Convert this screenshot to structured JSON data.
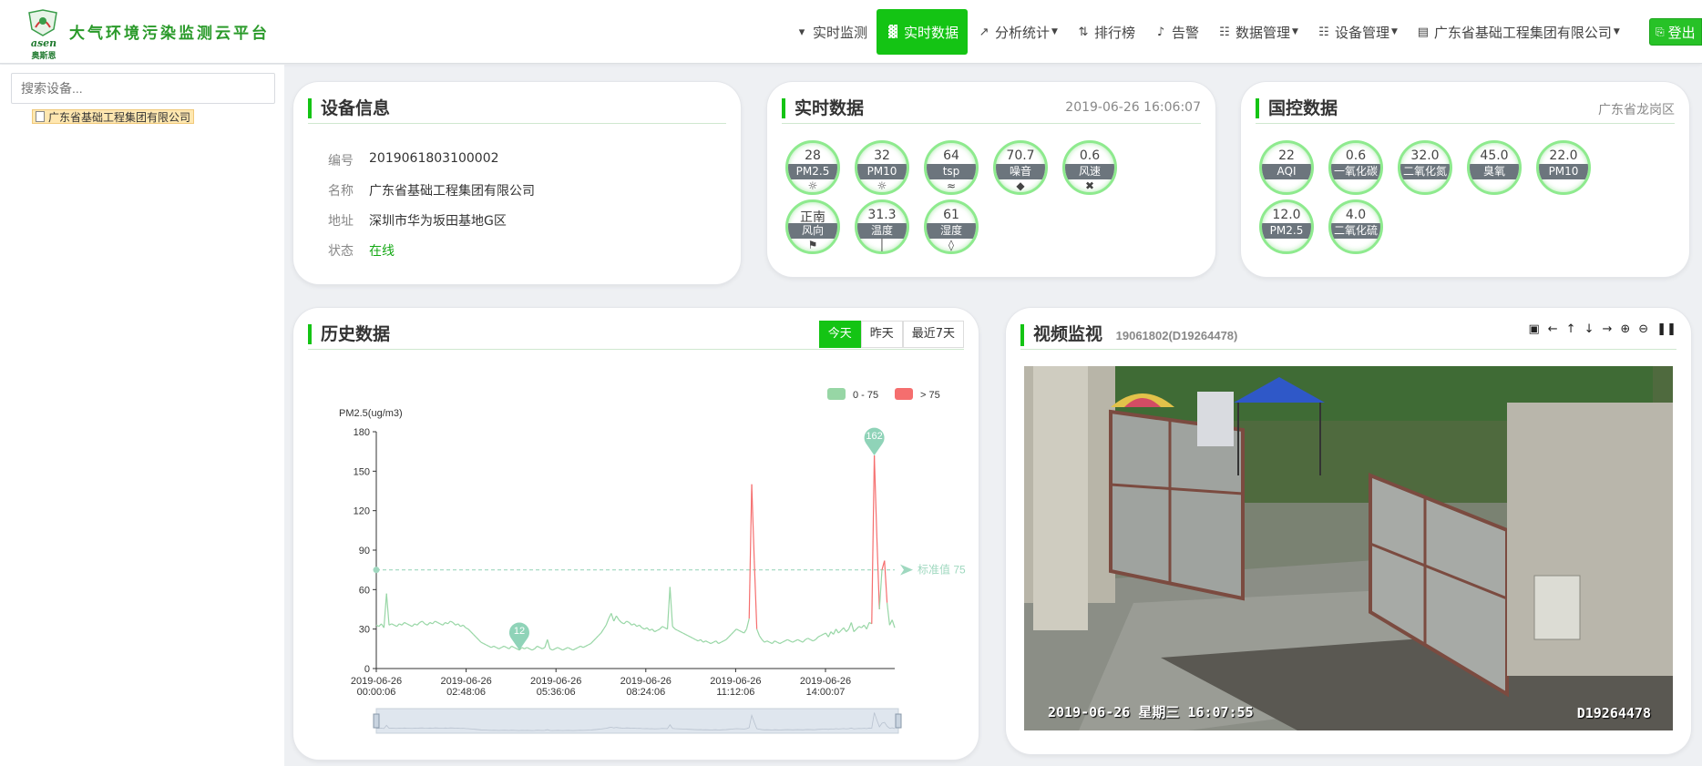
{
  "header": {
    "logo_en": "asen",
    "logo_cn": "奥斯恩",
    "app_title": "大气环境污染监测云平台",
    "nav": [
      {
        "label": "实时监测",
        "icon": "map-marker-icon",
        "active": false,
        "caret": false
      },
      {
        "label": "实时数据",
        "icon": "bar-chart-icon",
        "active": true,
        "caret": false
      },
      {
        "label": "分析统计",
        "icon": "line-chart-icon",
        "active": false,
        "caret": true
      },
      {
        "label": "排行榜",
        "icon": "sort-icon",
        "active": false,
        "caret": false
      },
      {
        "label": "告警",
        "icon": "bell-icon",
        "active": false,
        "caret": false
      },
      {
        "label": "数据管理",
        "icon": "sitemap-icon",
        "active": false,
        "caret": true
      },
      {
        "label": "设备管理",
        "icon": "sitemap-icon",
        "active": false,
        "caret": true
      },
      {
        "label": "广东省基础工程集团有限公司",
        "icon": "id-card-icon",
        "active": false,
        "caret": true
      }
    ],
    "logout": "登出"
  },
  "sidebar": {
    "search_placeholder": "搜索设备...",
    "tree": [
      {
        "label": "广东省基础工程集团有限公司",
        "selected": true
      }
    ]
  },
  "device_info": {
    "title": "设备信息",
    "rows": [
      {
        "key": "编号",
        "value": "2019061803100002"
      },
      {
        "key": "名称",
        "value": "广东省基础工程集团有限公司"
      },
      {
        "key": "地址",
        "value": "深圳市华为坂田基地G区"
      },
      {
        "key": "状态",
        "value": "在线"
      }
    ]
  },
  "realtime": {
    "title": "实时数据",
    "timestamp": "2019-06-26 16:06:07",
    "gauges": [
      {
        "value": "28",
        "label": "PM2.5",
        "icon": "sun-icon"
      },
      {
        "value": "32",
        "label": "PM10",
        "icon": "sun-icon"
      },
      {
        "value": "64",
        "label": "tsp",
        "icon": "haze-icon"
      },
      {
        "value": "70.7",
        "label": "噪音",
        "icon": "horn-icon"
      },
      {
        "value": "0.6",
        "label": "风速",
        "icon": "fan-icon"
      },
      {
        "value": "正南",
        "label": "风向",
        "icon": "flag-icon"
      },
      {
        "value": "31.3",
        "label": "温度",
        "icon": "thermometer-icon"
      },
      {
        "value": "61",
        "label": "湿度",
        "icon": "drop-icon"
      }
    ]
  },
  "national": {
    "title": "国控数据",
    "location": "广东省龙岗区",
    "gauges": [
      {
        "value": "22",
        "label": "AQI"
      },
      {
        "value": "0.6",
        "label": "一氧化碳"
      },
      {
        "value": "32.0",
        "label": "二氧化氮"
      },
      {
        "value": "45.0",
        "label": "臭氧"
      },
      {
        "value": "22.0",
        "label": "PM10"
      },
      {
        "value": "12.0",
        "label": "PM2.5"
      },
      {
        "value": "4.0",
        "label": "二氧化硫"
      }
    ]
  },
  "history": {
    "title": "历史数据",
    "ranges": [
      {
        "label": "今天",
        "active": true
      },
      {
        "label": "昨天",
        "active": false
      },
      {
        "label": "最近7天",
        "active": false
      }
    ]
  },
  "chart_data": {
    "type": "line",
    "ylabel": "PM2.5(ug/m3)",
    "ylim": [
      0,
      180
    ],
    "yticks": [
      0,
      30,
      60,
      90,
      120,
      150,
      180
    ],
    "xticks": [
      {
        "date": "2019-06-26",
        "time": "00:00:06"
      },
      {
        "date": "2019-06-26",
        "time": "02:48:06"
      },
      {
        "date": "2019-06-26",
        "time": "05:36:06"
      },
      {
        "date": "2019-06-26",
        "time": "08:24:06"
      },
      {
        "date": "2019-06-26",
        "time": "11:12:06"
      },
      {
        "date": "2019-06-26",
        "time": "14:00:07"
      }
    ],
    "legend": [
      {
        "label": "0 - 75",
        "color": "#97d6a5"
      },
      {
        "label": "> 75",
        "color": "#f56e6e"
      }
    ],
    "threshold": {
      "label": "标准值 75",
      "value": 75,
      "color": "#9fd8bf"
    },
    "markers": [
      {
        "label": "162",
        "value": 162
      },
      {
        "label": "12",
        "value": 12
      }
    ],
    "series": [
      {
        "values": [
          33,
          32,
          34,
          31,
          57,
          33,
          34,
          33,
          32,
          34,
          33,
          35,
          34,
          33,
          32,
          34,
          33,
          35,
          36,
          34,
          33,
          35,
          34,
          36,
          35,
          34,
          33,
          35,
          34,
          36,
          35,
          33,
          34,
          32,
          33,
          31,
          30,
          28,
          26,
          24,
          22,
          20,
          19,
          18,
          17,
          16,
          17,
          16,
          15,
          16,
          17,
          16,
          15,
          17,
          16,
          15,
          14,
          16,
          15,
          16,
          15,
          14,
          15,
          17,
          16,
          15,
          16,
          22,
          15,
          14,
          15,
          16,
          15,
          14,
          15,
          16,
          15,
          14,
          15,
          16,
          17,
          16,
          17,
          18,
          19,
          21,
          23,
          25,
          27,
          30,
          33,
          38,
          42,
          36,
          40,
          37,
          35,
          34,
          36,
          35,
          33,
          34,
          32,
          33,
          31,
          30,
          31,
          29,
          30,
          28,
          29,
          30,
          32,
          31,
          30,
          62,
          32,
          30,
          29,
          28,
          27,
          26,
          25,
          24,
          23,
          22,
          21,
          22,
          20,
          21,
          20,
          19,
          20,
          21,
          19,
          20,
          21,
          22,
          24,
          26,
          28,
          30,
          29,
          28,
          27,
          30,
          38,
          140,
          82,
          30,
          25,
          22,
          20,
          21,
          20,
          19,
          21,
          20,
          19,
          20,
          21,
          22,
          21,
          20,
          21,
          22,
          21,
          20,
          22,
          23,
          22,
          21,
          22,
          24,
          25,
          26,
          27,
          24,
          28,
          26,
          30,
          27,
          29,
          31,
          28,
          30,
          35,
          28,
          30,
          32,
          31,
          33,
          30,
          35,
          34,
          162,
          100,
          45,
          75,
          82,
          50,
          33,
          37,
          31
        ]
      }
    ],
    "crosses_threshold_color": "#f56e6e"
  },
  "video": {
    "title": "视频监视",
    "device_id": "19061802(D19264478)",
    "timestamp_overlay": "2019-06-26  星期三  16:07:55",
    "camera_id_overlay": "D19264478",
    "tools": [
      "camera-icon",
      "arrow-left-icon",
      "arrow-up-icon",
      "arrow-down-icon",
      "arrow-right-icon",
      "zoom-in-icon",
      "zoom-out-icon",
      "pause-icon"
    ]
  }
}
